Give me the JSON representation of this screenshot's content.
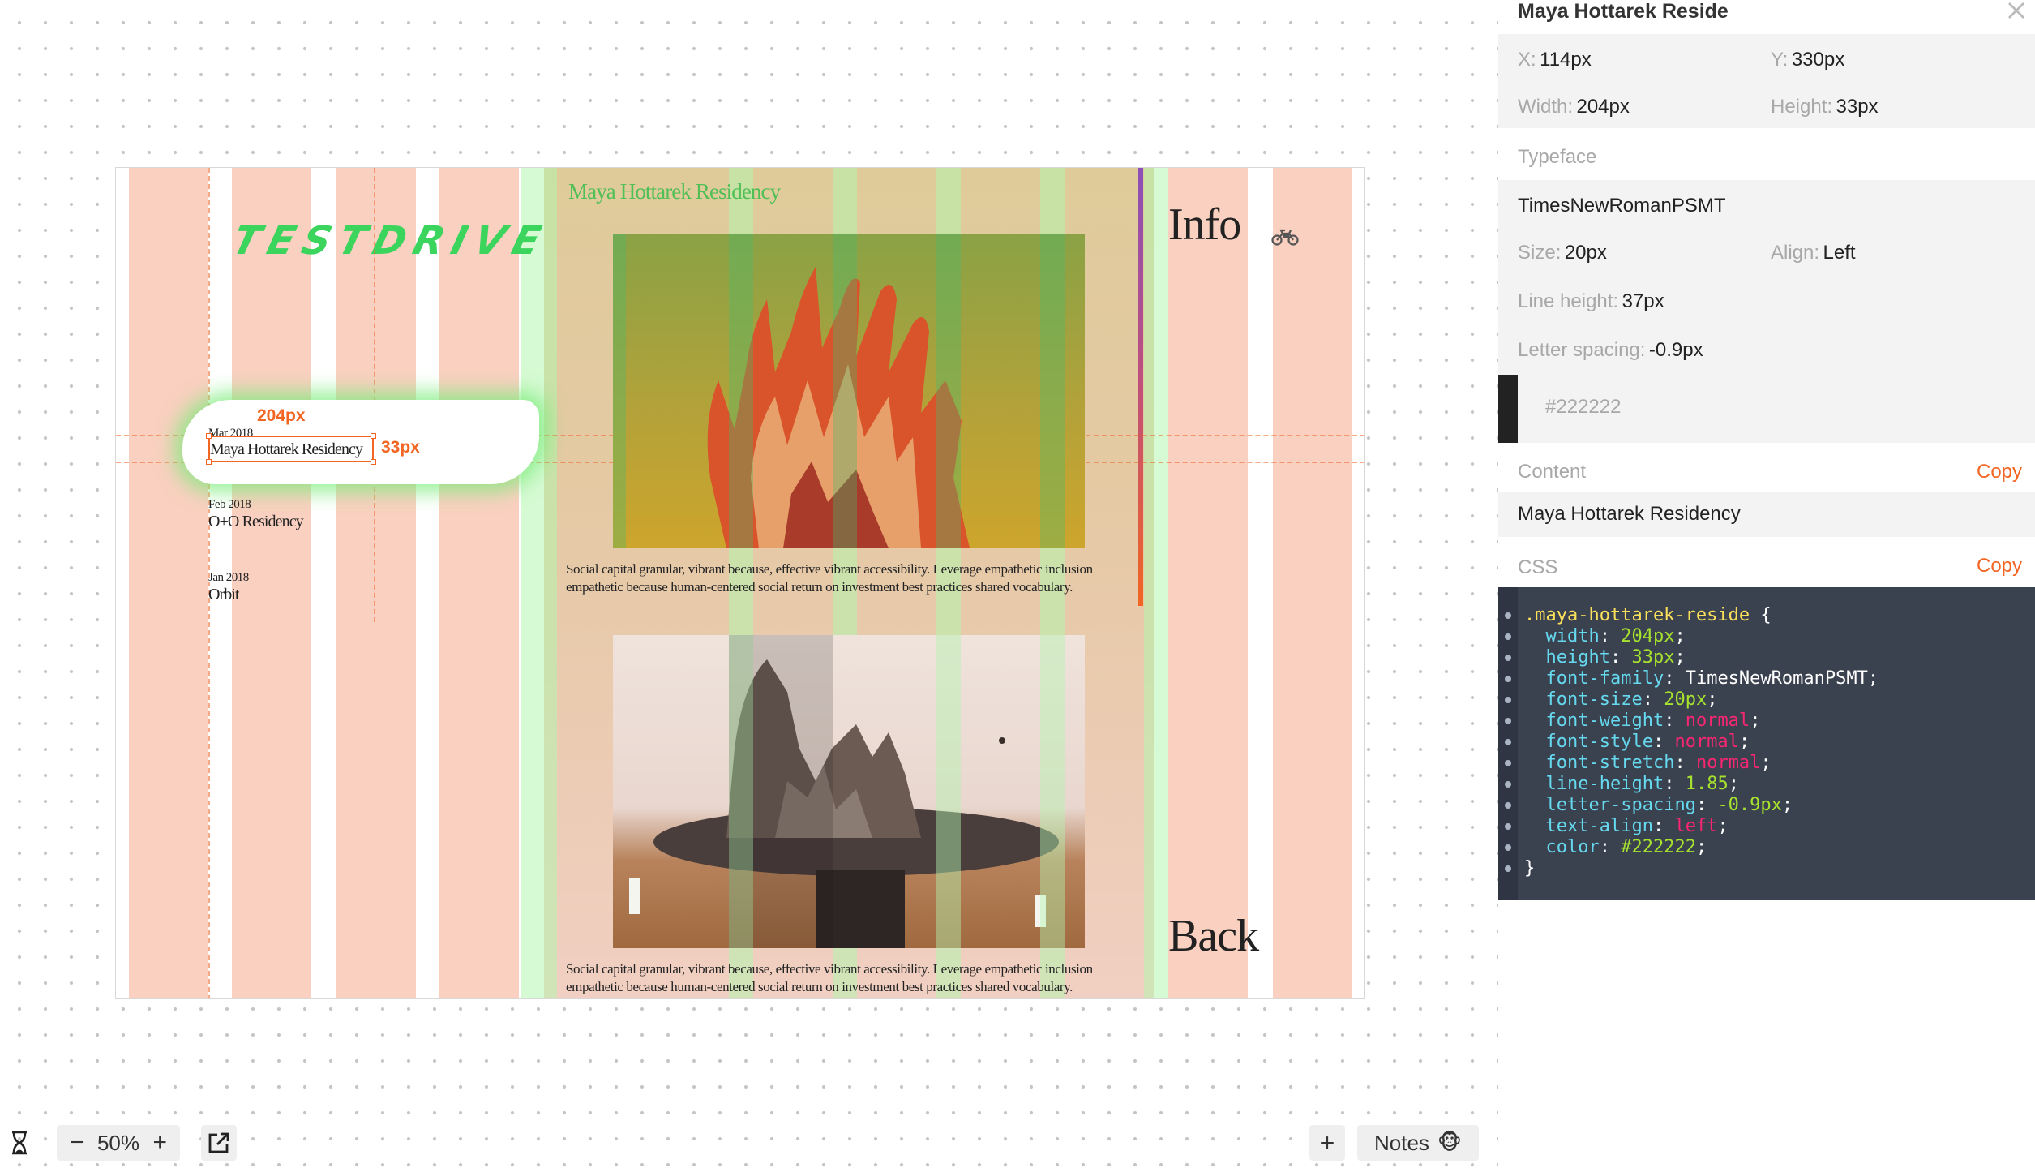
{
  "artboard": {
    "logo_text": "TESTDRIVE",
    "list": [
      {
        "date": "Mar 2018",
        "title": "Maya Hottarek Residency"
      },
      {
        "date": "Feb 2018",
        "title": "O+O Residency"
      },
      {
        "date": "Jan 2018",
        "title": "Orbit"
      }
    ],
    "measure": {
      "width_label": "204px",
      "height_label": "33px"
    },
    "center_title": "Maya Hottarek Residency",
    "paragraph": "Social capital granular, vibrant because, effective vibrant accessibility. Leverage empathetic inclusion empathetic because human-centered social return on investment best practices shared vocabulary.",
    "info_label": "Info",
    "back_label": "Back",
    "motorcycle_icon": "motorcycle-icon"
  },
  "toolbar": {
    "zoom": "50%",
    "minus": "−",
    "plus": "+",
    "add": "+",
    "notes_label": "Notes",
    "notes_emoji": "🐵"
  },
  "panel": {
    "title": "Maya Hottarek Reside",
    "x_label": "X:",
    "x_value": "114px",
    "y_label": "Y:",
    "y_value": "330px",
    "width_label": "Width:",
    "width_value": "204px",
    "height_label": "Height:",
    "height_value": "33px",
    "typeface_label": "Typeface",
    "typeface_value": "TimesNewRomanPSMT",
    "size_label": "Size:",
    "size_value": "20px",
    "align_label": "Align:",
    "align_value": "Left",
    "line_height_label": "Line height:",
    "line_height_value": "37px",
    "letter_spacing_label": "Letter spacing:",
    "letter_spacing_value": "-0.9px",
    "color_value": "#222222",
    "content_label": "Content",
    "content_copy": "Copy",
    "content_value": "Maya Hottarek Residency",
    "css_label": "CSS",
    "css_copy": "Copy",
    "css": {
      "selector": ".maya-hottarek-reside",
      "open": " {",
      "close": "}",
      "props": [
        {
          "k": "width",
          "v": "204px",
          "t": "v"
        },
        {
          "k": "height",
          "v": "33px",
          "t": "v"
        },
        {
          "k": "font-family",
          "v": "TimesNewRomanPSMT",
          "t": "w"
        },
        {
          "k": "font-size",
          "v": "20px",
          "t": "v"
        },
        {
          "k": "font-weight",
          "v": "normal",
          "t": "s"
        },
        {
          "k": "font-style",
          "v": "normal",
          "t": "s"
        },
        {
          "k": "font-stretch",
          "v": "normal",
          "t": "s"
        },
        {
          "k": "line-height",
          "v": "1.85",
          "t": "v"
        },
        {
          "k": "letter-spacing",
          "v": "-0.9px",
          "t": "v"
        },
        {
          "k": "text-align",
          "v": "left",
          "t": "s"
        },
        {
          "k": "color",
          "v": "#222222",
          "t": "v"
        }
      ]
    }
  },
  "colors": {
    "accent": "#f26522",
    "column_pink": "#f6c4b2",
    "column_green": "#c9f5c3",
    "swatch": "#222222"
  }
}
